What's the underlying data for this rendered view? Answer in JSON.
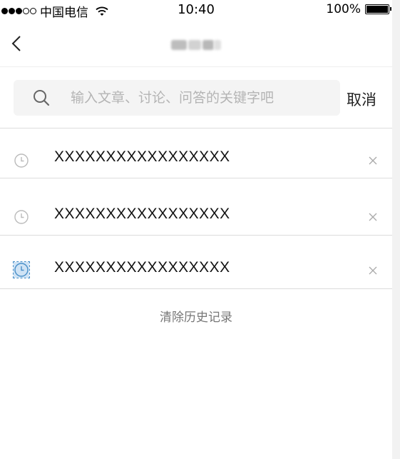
{
  "status_bar": {
    "carrier": "中国电信",
    "time": "10:40",
    "battery": "100%",
    "signal_bars_filled": 3,
    "signal_bars_total": 5
  },
  "nav": {
    "back_icon": "chevron-left-icon"
  },
  "search": {
    "value": "",
    "placeholder": "输入文章、讨论、问答的关键字吧",
    "cancel_label": "取消",
    "icon": "search-icon"
  },
  "history": {
    "items": [
      {
        "label": "XXXXXXXXXXXXXXXXX",
        "icon": "clock-icon",
        "delete_icon": "close-icon"
      },
      {
        "label": "XXXXXXXXXXXXXXXXX",
        "icon": "clock-icon",
        "delete_icon": "close-icon"
      },
      {
        "label": "XXXXXXXXXXXXXXXXX",
        "icon": "clock-icon",
        "delete_icon": "close-icon"
      }
    ],
    "clear_label": "清除历史记录"
  },
  "colors": {
    "background": "#ffffff",
    "search_box": "#f4f4f4",
    "placeholder": "#b4b4b4",
    "divider": "#dcdcdc",
    "secondary_text": "#777777"
  }
}
